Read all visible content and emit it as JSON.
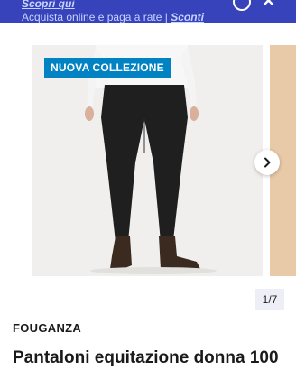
{
  "promo": {
    "link": "Scopri qui",
    "text": "Acquista online e paga a rate |",
    "text_emphasis": "Sconti"
  },
  "gallery": {
    "badge": "NUOVA COLLEZIONE",
    "next_icon": "chevron-right-icon",
    "pager": "1/7"
  },
  "product": {
    "brand": "FOUGANZA",
    "title": "Pantaloni equitazione donna 100"
  },
  "colors": {
    "promo_bg": "#3643ba",
    "badge_bg": "#0082c3"
  }
}
